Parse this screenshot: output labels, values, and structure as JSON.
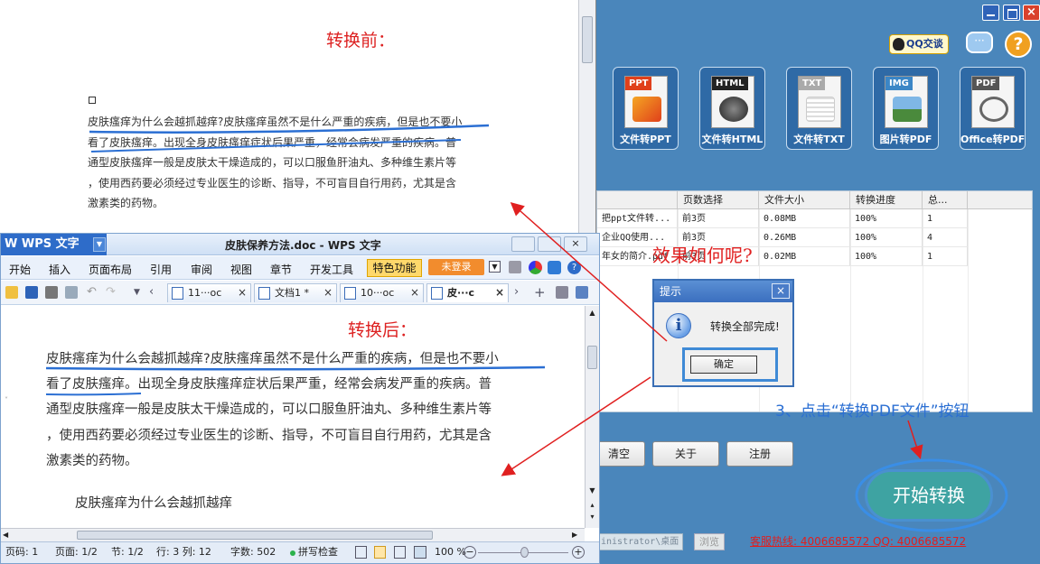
{
  "top_doc": {
    "label_before": "转换前：",
    "lines": [
      "皮肤瘙痒为什么会越抓越痒?皮肤瘙痒虽然不是什么严重的疾病，但是也不要小",
      "看了皮肤瘙痒。出现全身皮肤瘙痒症状后果严重，经常会病发严重的疾病。普",
      "通型皮肤瘙痒一般是皮肤太干燥造成的，可以口服鱼肝油丸、多种维生素片等",
      "，使用西药要必须经过专业医生的诊断、指导，不可盲目自行用药，尤其是含",
      "激素类的药物。"
    ]
  },
  "wps": {
    "app_name": "WPS 文字",
    "title": "皮肤保养方法.doc - WPS 文字",
    "menu": [
      "开始",
      "插入",
      "页面布局",
      "引用",
      "审阅",
      "视图",
      "章节",
      "开发工具",
      "特色功能",
      "未登录"
    ],
    "tabs": [
      {
        "label": "11···oc",
        "close": "×"
      },
      {
        "label": "文档1 *",
        "close": "×"
      },
      {
        "label": "10···oc",
        "close": "×"
      },
      {
        "label": "皮···c",
        "close": "×"
      }
    ],
    "label_after": "转换后：",
    "lines": [
      "皮肤瘙痒为什么会越抓越痒?皮肤瘙痒虽然不是什么严重的疾病，但是也不要小",
      "看了皮肤瘙痒。出现全身皮肤瘙痒症状后果严重，经常会病发严重的疾病。普",
      "通型皮肤瘙痒一般是皮肤太干燥造成的，可以口服鱼肝油丸、多种维生素片等",
      "，使用西药要必须经过专业医生的诊断、指导，不可盲目自行用药，尤其是含",
      "激素类的药物。"
    ],
    "heading": "皮肤瘙痒为什么会越抓越痒",
    "status": {
      "page": "页码: 1",
      "pages": "页面: 1/2",
      "section": "节: 1/2",
      "row_col": "行: 3 列: 12",
      "words": "字数: 502",
      "spell": "拼写检查",
      "zoom": "100 %"
    }
  },
  "converter": {
    "qq": "QQ交谈",
    "chat_icon_text": "···",
    "help_icon_text": "?",
    "formats": [
      {
        "tag": "PPT",
        "label": "文件转PPT",
        "color": "#e0401b"
      },
      {
        "tag": "HTML",
        "label": "文件转HTML",
        "color": "#222222"
      },
      {
        "tag": "TXT",
        "label": "文件转TXT",
        "color": "#bbbbbb"
      },
      {
        "tag": "IMG",
        "label": "图片转PDF",
        "color": "#3b86c6"
      },
      {
        "tag": "PDF",
        "label": "Office转PDF",
        "color": "#555555"
      }
    ],
    "table": {
      "headers": [
        "",
        "页数选择",
        "文件大小",
        "转换进度",
        "总..."
      ],
      "rows": [
        [
          "把ppt文件转...",
          "前3页",
          "0.08MB",
          "100%",
          "1"
        ],
        [
          "企业QQ使用...",
          "前3页",
          "0.26MB",
          "100%",
          "4"
        ],
        [
          "年女的简介.pdf",
          "前3页",
          "0.02MB",
          "100%",
          "1"
        ]
      ]
    },
    "buttons": {
      "clear": "清空",
      "about": "关于",
      "register": "注册",
      "start": "开始转换",
      "browse": "浏览"
    },
    "path_value": "inistrator\\桌面",
    "hotline": "客服热线: 4006685572 QQ: 4006685572"
  },
  "dialog": {
    "title": "提示",
    "close": "×",
    "icon": "i",
    "message": "转换全部完成!",
    "ok": "确定"
  },
  "annotations": {
    "effect": "效果如何呢?",
    "step3": "3、点击“转换PDF文件”按钮"
  }
}
